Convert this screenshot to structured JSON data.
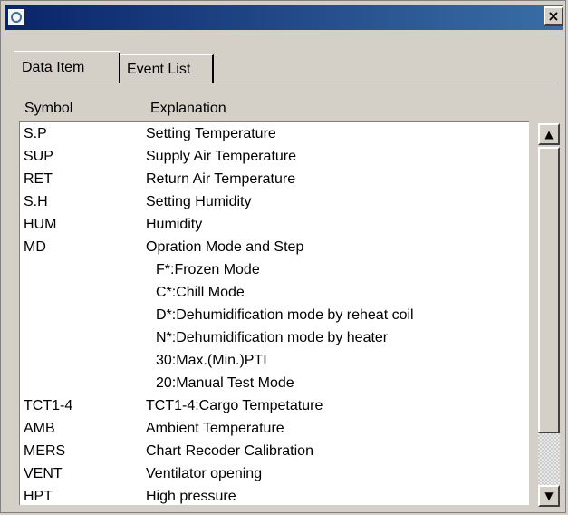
{
  "window": {
    "close_glyph": "×",
    "icon": "app-icon"
  },
  "tabs": [
    {
      "label": "Data Item"
    },
    {
      "label": "Event List"
    }
  ],
  "columns": {
    "symbol": "Symbol",
    "explanation": "Explanation"
  },
  "rows": [
    {
      "symbol": "S.P",
      "explanation": "Setting Temperature"
    },
    {
      "symbol": "SUP",
      "explanation": "Supply Air Temperature"
    },
    {
      "symbol": "RET",
      "explanation": "Return Air Temperature"
    },
    {
      "symbol": "S.H",
      "explanation": "Setting Humidity"
    },
    {
      "symbol": "HUM",
      "explanation": "Humidity"
    },
    {
      "symbol": "MD",
      "explanation": "Opration Mode and Step"
    },
    {
      "symbol": "",
      "explanation": "F*:Frozen Mode"
    },
    {
      "symbol": "",
      "explanation": "C*:Chill Mode"
    },
    {
      "symbol": "",
      "explanation": "D*:Dehumidification mode by reheat coil"
    },
    {
      "symbol": "",
      "explanation": "N*:Dehumidification mode by heater"
    },
    {
      "symbol": "",
      "explanation": "30:Max.(Min.)PTI"
    },
    {
      "symbol": "",
      "explanation": "20:Manual Test Mode"
    },
    {
      "symbol": "TCT1-4",
      "explanation": "TCT1-4:Cargo Tempetature"
    },
    {
      "symbol": "AMB",
      "explanation": "Ambient Temperature"
    },
    {
      "symbol": "MERS",
      "explanation": "Chart Recoder Calibration"
    },
    {
      "symbol": "VENT",
      "explanation": "Ventilator opening"
    },
    {
      "symbol": "HPT",
      "explanation": "High pressure"
    }
  ],
  "scrollbar": {
    "up_glyph": "▲",
    "down_glyph": "▼"
  }
}
